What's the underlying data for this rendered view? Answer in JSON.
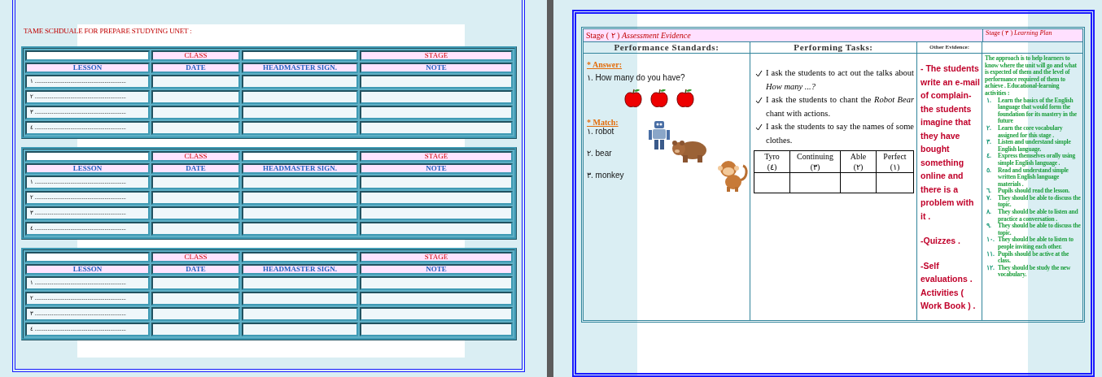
{
  "schedule": {
    "title": "TAME SCHDUALE FOR  PREPARE STUDYING UNET :",
    "tables": [
      {
        "class_label": "CLASS",
        "stage_label": "STAGE",
        "columns": [
          "LESSON",
          "DATE",
          "HEADMASTER SIGN.",
          "NOTE"
        ],
        "rows": [
          "١ ................................................................",
          "٢ ................................................................",
          "٣ ................................................................",
          "٤ ................................................................"
        ]
      },
      {
        "class_label": "CLASS",
        "stage_label": "STAGE",
        "columns": [
          "LESSON",
          "DATE",
          "HEADMASTER SIGN.",
          "NOTE"
        ],
        "rows": [
          "١ ................................................................",
          "٢ ................................................................",
          "٣ ................................................................",
          "٤ ................................................................"
        ]
      },
      {
        "class_label": "CLASS",
        "stage_label": "STAGE",
        "columns": [
          "LESSON",
          "DATE",
          "HEADMASTER SIGN.",
          "NOTE"
        ],
        "rows": [
          "١ ................................................................",
          "٢ ................................................................",
          "٣ ................................................................",
          "٤ ................................................................"
        ]
      }
    ]
  },
  "plan": {
    "assessment_title": "Stage ( ٢ ) *Assessment Evidence*",
    "learning_plan_title": "Stage ( ٣ ) *Learning Plan*",
    "columns": [
      "Performance Standards:",
      "Performing Tasks:",
      "Other Evidence:"
    ],
    "standards": {
      "answer_heading": "* Answer:",
      "question": "١. How many do you have?",
      "match_heading": "* Match:",
      "match_items": [
        {
          "text": "١. robot",
          "kind": "robot"
        },
        {
          "text": "٢. bear",
          "kind": "bear"
        },
        {
          "text": "٣. monkey",
          "kind": "monkey"
        }
      ]
    },
    "tasks": [
      "I ask the students to act out the talks about *How many ...?*",
      "I ask the students to chant the *Robot Bear* chant with actions.",
      "I ask the students to say the names of some clothes."
    ],
    "rubric": [
      "Tyro (٤)",
      "Continuing (٣)",
      "Able (٢)",
      "Perfect (١)"
    ],
    "other_evidence": [
      "- The students write an e-mail of complain-the students imagine that they have bought something online and there is a problem with it  .",
      "-Quizzes .",
      "-Self evaluations . Activities ( Work Book ) ."
    ],
    "learning_plan": {
      "intro": "The approach is to help learners to know where the unit will go and what is expected of them and the level of performance required of them to achieve . Educational-learning activities :",
      "items": [
        {
          "number": "١.",
          "text": "Learn the basics of the English language that would form the foundation for its mastery in the future"
        },
        {
          "number": "٢.",
          "text": "Learn the core vocabulary assigned for this stage ."
        },
        {
          "number": "٣.",
          "text": "Listen and understand simple English language."
        },
        {
          "number": "٤.",
          "text": "Express themselves orally using simple English language ."
        },
        {
          "number": "٥.",
          "text": "Read and understand simple written  English language materials ."
        },
        {
          "number": "٦.",
          "text": "Pupils should read the lesson."
        },
        {
          "number": "٧.",
          "text": "They should be able to discuss the topic."
        },
        {
          "number": "٨.",
          "text": "They should be able to listen and practice a conversation ."
        },
        {
          "number": "٩.",
          "text": "They should be able to discuss the topic."
        },
        {
          "number": "١٠.",
          "text": "They should be able to listen to people inviting each other."
        },
        {
          "number": "١١.",
          "text": "Pupils should be active at the class."
        },
        {
          "number": "١٢.",
          "text": "They should be study the new vocabulary."
        }
      ]
    }
  }
}
